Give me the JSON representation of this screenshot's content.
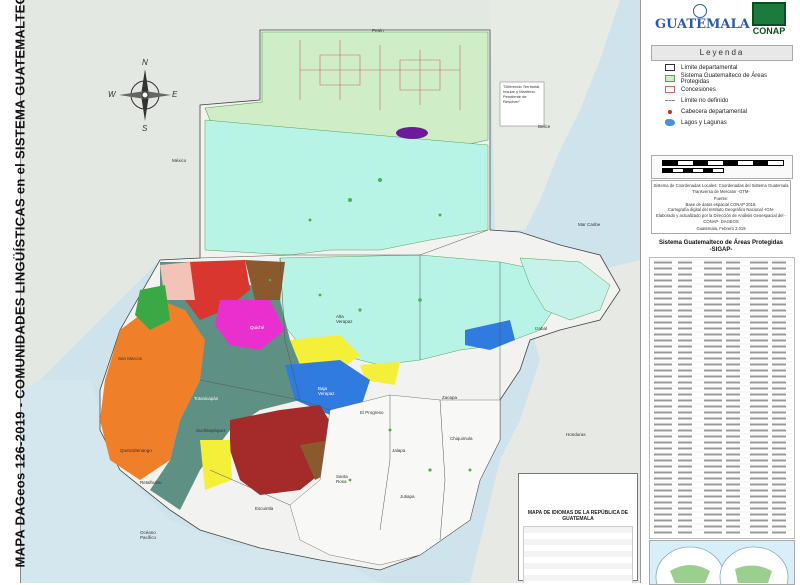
{
  "title": {
    "vertical": "MAPA DAGeos 126-2019 - COMUNIDADES LINGÜÍSTICAS en el  SISTEMA GUATEMALTECO DE ÁREAS PROTEGIDAS"
  },
  "logos": {
    "guatemala": "GUATEMALA",
    "conap": "CONAP"
  },
  "legend": {
    "title": "Leyenda",
    "items": [
      {
        "label": "Límite departamental",
        "fill": "#ffffff",
        "stroke": "#333333"
      },
      {
        "label": "Sistema Guatemalteco de Áreas Protegidas",
        "fill": "#cfeec8",
        "stroke": "#5aa05a"
      },
      {
        "label": "Concesiones",
        "fill": "#ffffff",
        "stroke": "#cc6666"
      },
      {
        "label": "Límite no definido",
        "fill": "none",
        "stroke": "#888888"
      },
      {
        "label": "Cabecera departamental",
        "fill": "#dd2222",
        "stroke": "#dd2222"
      },
      {
        "label": "Lagos y Lagunas",
        "fill": "#4a90e2",
        "stroke": "#4a90e2"
      }
    ]
  },
  "source": {
    "line1": "Sistema de Coordenadas Locales: Coordenadas del Sistema Guatemala Transversa de Mercator -GTM-",
    "line2": "Fuente:",
    "line3": "Base de datos espacial CONAP 2018.",
    "line4": "Cartografía digital del Instituto Geográfico Nacional -IGN-",
    "line5": "Elaborado y actualizado por la Dirección de Análisis Geoespacial del -CONAP- DAGEOS",
    "line6": "Guatemala, Febrero 2,019"
  },
  "sigap": {
    "title": "Sistema Guatemalteco de Áreas Protegidas",
    "subtitle": "-SIGAP-"
  },
  "compass": {
    "n": "N",
    "s": "S",
    "e": "E",
    "w": "W"
  },
  "map_labels": {
    "mexico": "México",
    "belize": "Belice",
    "honduras": "Honduras",
    "el_salvador": "El Salvador",
    "oceano": "Océano Pacífico",
    "caribe": "Mar Caribe",
    "peten": "Petén",
    "diferendo": "\"Diferendo Territorial, Insular y Marítimo Pendiente de Resolver\"",
    "alta_verapaz": "Alta Verapaz",
    "izabal": "Izabal",
    "quiche": "Quiché",
    "san_marcos": "San Marcos",
    "baja_verapaz": "Baja Verapaz",
    "zacapa": "Zacapa",
    "el_progreso": "El Progreso",
    "chiquimula": "Chiquimula",
    "jalapa": "Jalapa",
    "santa_rosa": "Santa Rosa",
    "jutiapa": "Jutiapa",
    "escuintla": "Escuintla",
    "retalhuleu": "Retalhuleu",
    "suchitepequez": "Suchitepéquez",
    "totonicapan": "Totonicapán",
    "quetzaltenango": "Quetzaltenango"
  },
  "inset": {
    "title": "MAPA DE IDIOMAS DE LA REPÚBLICA DE GUATEMALA"
  },
  "colors": {
    "sea": "#cfe3ec",
    "land": "#e9ece6",
    "protected": "#cfeec8",
    "orange": "#f07f2a",
    "red": "#d8362e",
    "darkred": "#a52a2a",
    "teal": "#5e9183",
    "magenta": "#ea2fcf",
    "yellow": "#f4f03a",
    "blue": "#2f7be0",
    "brown": "#8a5a2e",
    "tan": "#d8b382",
    "cyan": "#b8f4e6",
    "purple": "#6a1a9a"
  }
}
